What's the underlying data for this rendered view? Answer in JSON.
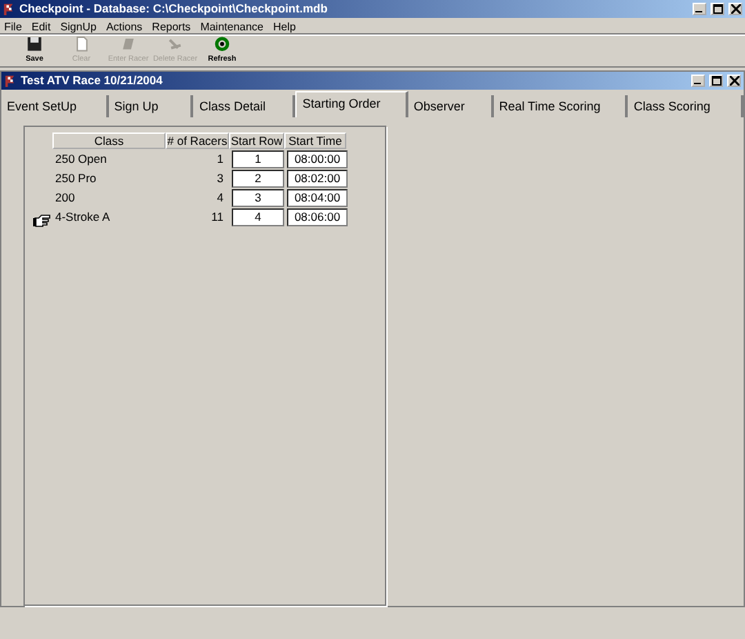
{
  "window": {
    "title": "Checkpoint - Database: C:\\Checkpoint\\Checkpoint.mdb"
  },
  "menu": [
    "File",
    "Edit",
    "SignUp",
    "Actions",
    "Reports",
    "Maintenance",
    "Help"
  ],
  "toolbar": [
    {
      "label": "Save",
      "disabled": false,
      "kind": "save"
    },
    {
      "label": "Clear",
      "disabled": true,
      "kind": "clear"
    },
    {
      "label": "Enter Racer",
      "disabled": true,
      "kind": "enter"
    },
    {
      "label": "Delete Racer",
      "disabled": true,
      "kind": "delete"
    },
    {
      "label": "Refresh",
      "disabled": false,
      "kind": "refresh"
    }
  ],
  "child_window": {
    "title": "Test ATV Race  10/21/2004"
  },
  "tabs": [
    {
      "label": "Event SetUp",
      "selected": false
    },
    {
      "label": "Sign Up",
      "selected": false
    },
    {
      "label": "Class Detail",
      "selected": false
    },
    {
      "label": "Starting Order",
      "selected": true
    },
    {
      "label": "Observer",
      "selected": false
    },
    {
      "label": "Real Time Scoring",
      "selected": false
    },
    {
      "label": "Class Scoring",
      "selected": false
    }
  ],
  "table": {
    "columns": [
      "Class",
      "# of Racers",
      "Start Row",
      "Start Time"
    ],
    "rows": [
      {
        "class": "250 Open",
        "racers": "1",
        "start_row": "1",
        "start_time": "08:00:00",
        "current": false
      },
      {
        "class": "250 Pro",
        "racers": "3",
        "start_row": "2",
        "start_time": "08:02:00",
        "current": false
      },
      {
        "class": "200",
        "racers": "4",
        "start_row": "3",
        "start_time": "08:04:00",
        "current": false
      },
      {
        "class": "4-Stroke A",
        "racers": "11",
        "start_row": "4",
        "start_time": "08:06:00",
        "current": true
      }
    ]
  }
}
